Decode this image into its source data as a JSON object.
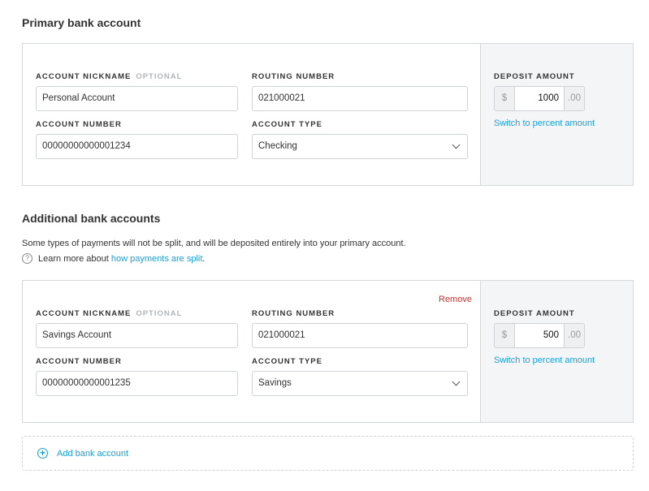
{
  "primary": {
    "title": "Primary bank account",
    "nickname_label": "ACCOUNT NICKNAME",
    "optional": "OPTIONAL",
    "nickname": "Personal Account",
    "routing_label": "ROUTING NUMBER",
    "routing": "021000021",
    "number_label": "ACCOUNT NUMBER",
    "number": "00000000000001234",
    "type_label": "ACCOUNT TYPE",
    "type": "Checking",
    "deposit_label": "DEPOSIT AMOUNT",
    "currency": "$",
    "amount": "1000",
    "cents": ".00",
    "switch": "Switch to percent amount"
  },
  "additional": {
    "title": "Additional bank accounts",
    "note": "Some types of payments will not be split, and will be deposited entirely into your primary account.",
    "learn": "Learn more about ",
    "learn_link": "how payments are split",
    "period": ".",
    "account": {
      "remove": "Remove",
      "nickname_label": "ACCOUNT NICKNAME",
      "optional": "OPTIONAL",
      "nickname": "Savings Account",
      "routing_label": "ROUTING NUMBER",
      "routing": "021000021",
      "number_label": "ACCOUNT NUMBER",
      "number": "00000000000001235",
      "type_label": "ACCOUNT TYPE",
      "type": "Savings",
      "deposit_label": "DEPOSIT AMOUNT",
      "currency": "$",
      "amount": "500",
      "cents": ".00",
      "switch": "Switch to percent amount"
    },
    "add": "Add bank account"
  },
  "colors": {
    "link": "#1a9fd9",
    "remove": "#d0312d"
  }
}
